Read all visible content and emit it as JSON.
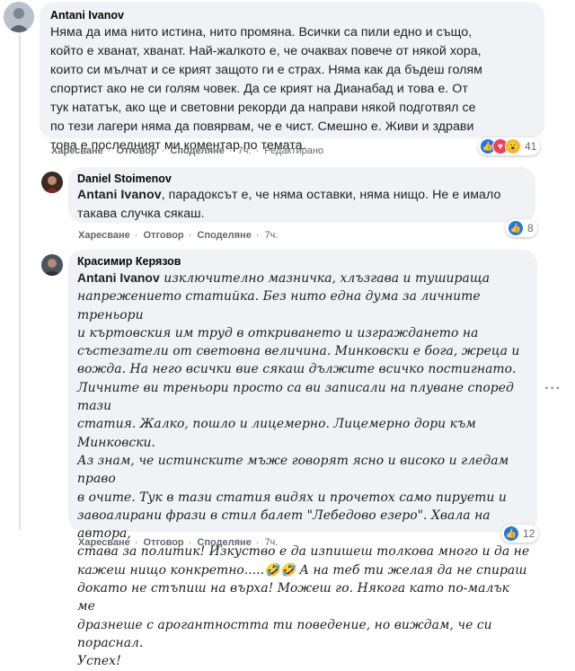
{
  "comments": [
    {
      "author": "Antani Ivanov",
      "lines": [
        "Няма да има нито истина, нито промяна. Всички са пили едно и също,",
        "който е хванат, хванат. Най-жалкото е, че очаквах повече от някой хора,",
        "които си мълчат и се крият защото ги е страх. Няма как да бъдеш голям",
        "спортист ако не си голям човек. Да се крият на Дианабад и това е. От",
        "тук нататък, ако ще и световни рекорди да направи някой подготвял се",
        "по тези лагери няма да повярвам, че е чист. Смешно е. Живи и здрави",
        "това е последният ми коментар по темата."
      ],
      "actions": {
        "like": "Харесване",
        "reply": "Отговор",
        "share": "Споделяне",
        "time": "7ч.",
        "edited": "Редактирано"
      },
      "reaction_count": "41",
      "reaction_icons": [
        "like-icon",
        "love-icon",
        "wow-icon"
      ]
    },
    {
      "author": "Daniel Stoimenov",
      "mention": "Antani Ivanov",
      "lines": [
        ", парадоксът е, че няма оставки, няма нищо. Не е имало",
        "такава случка сякаш."
      ],
      "actions": {
        "like": "Харесване",
        "reply": "Отговор",
        "share": "Споделяне",
        "time": "7ч."
      },
      "reaction_count": "8",
      "reaction_icons": [
        "like-icon"
      ]
    },
    {
      "author": "Красимир Керязов",
      "mention": "Antani Ivanov",
      "lines": [
        " изключително мазничка, хлъзгава и тушираща",
        "напрежението статийка. Без нито една дума за личните треньори",
        "и къртовския им труд в откриването и изграждането на",
        "състезатели от световна величина. Минковски е бога, жреца и",
        "вожда. На него всички вие сякаш дължите всичко постигнато.",
        "Личните ви треньори просто са ви записали на плуване според тази",
        "статия. Жалко, пошло и лицемерно. Лицемерно дори към Минковски.",
        "Аз знам, че истинските мъже говорят ясно и високо и гледам право",
        "в очите. Тук в тази статия видях и прочетох само пируети и",
        "завоалирани фрази в стил балет \"Лебедово езеро\". Хвала на автора,",
        "става за политик! Изкуство е да изпишеш толкова много и да не",
        "кажеш нищо конкретно.....🤣🤣 А на теб ти желая да не спираш",
        "докато не стъпиш на върха! Можеш го. Някога като по-малък ме",
        "дразнеше с арогантността ти поведение, но виждам, че си пораснал.",
        "Успех!"
      ],
      "actions": {
        "like": "Харесване",
        "reply": "Отговор",
        "share": "Споделяне",
        "time": "7ч."
      },
      "reaction_count": "12",
      "reaction_icons": [
        "like-icon"
      ]
    }
  ],
  "more_options": "···",
  "colors": {
    "like": "#1877f2",
    "love": "#f33e58",
    "wow": "#f7b928",
    "bubble": "#f0f2f5",
    "meta": "#65676b"
  }
}
